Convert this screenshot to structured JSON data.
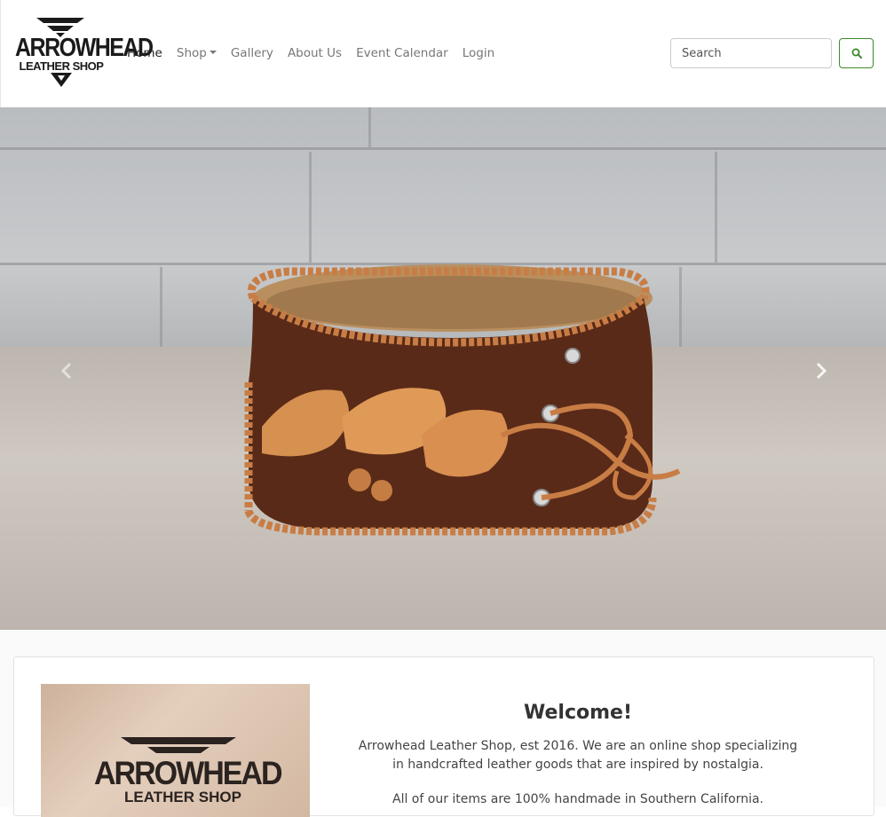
{
  "brand": {
    "logo_line1": "ARROWHEAD",
    "logo_line2": "LEATHER SHOP"
  },
  "nav": {
    "items": [
      {
        "label": "Home",
        "active": true
      },
      {
        "label": "Shop",
        "dropdown": true
      },
      {
        "label": "Gallery"
      },
      {
        "label": "About Us"
      },
      {
        "label": "Event Calendar"
      },
      {
        "label": "Login"
      }
    ]
  },
  "search": {
    "placeholder": "Search",
    "button_icon": "search-icon",
    "accent_color": "#3c8a2e"
  },
  "hero": {
    "subject": "leather-cuff-image",
    "prev_icon": "chevron-left-icon",
    "next_icon": "chevron-right-icon"
  },
  "welcome": {
    "title": "Welcome!",
    "paragraph1": "Arrowhead Leather Shop, est 2016. We are an online shop specializing in handcrafted leather goods that are inspired by nostalgia.",
    "paragraph2": "All of our items are 100% handmade in Southern California.",
    "image_logo_line1": "ARROWHEAD",
    "image_logo_line2": "LEATHER SHOP"
  }
}
